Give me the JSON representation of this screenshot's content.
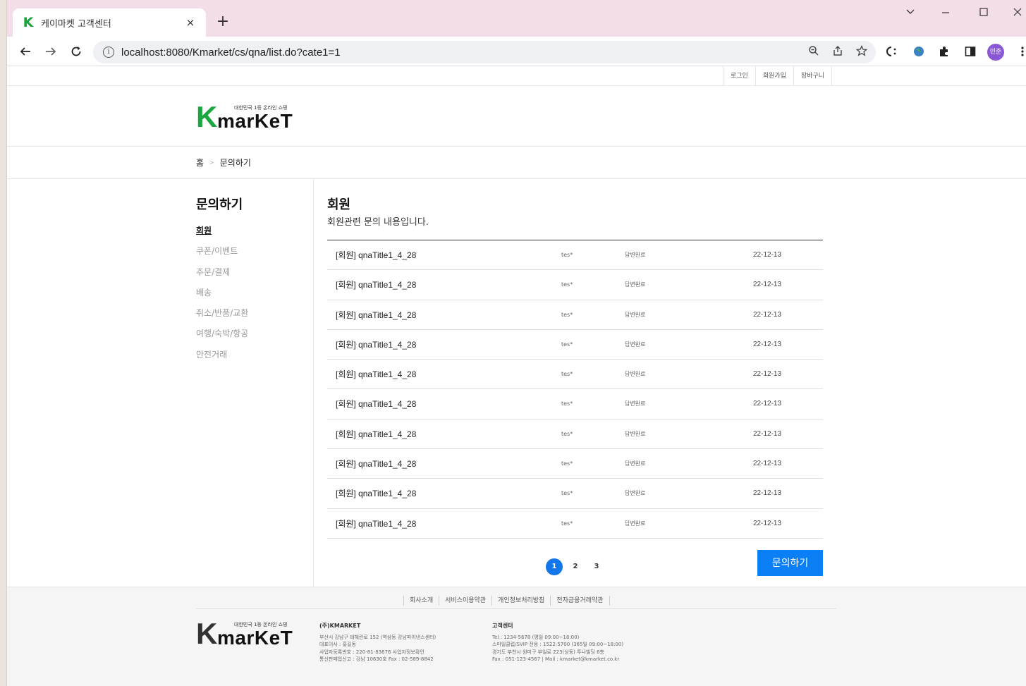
{
  "browser": {
    "tab_title": "케이마켓 고객센터",
    "tab_favicon": "K",
    "tab_close": "×",
    "new_tab": "+",
    "url": "localhost:8080/Kmarket/cs/qna/list.do?cate1=1",
    "profile_label": "민준",
    "icons": [
      "back-icon",
      "forward-icon",
      "reload-icon",
      "info-icon",
      "zoom-icon",
      "share-icon",
      "star-icon",
      "extension-icon",
      "puzzle-icon",
      "sidepanel-icon",
      "menu-icon"
    ]
  },
  "topbar": {
    "links": [
      "로그인",
      "회원가입",
      "장바구니"
    ]
  },
  "logo": {
    "k": "K",
    "word": "marKeT",
    "tagline": "대한민국 1등 온라인 쇼핑"
  },
  "breadcrumb": {
    "home": "홈",
    "current": "문의하기"
  },
  "aside": {
    "title": "문의하기",
    "items": [
      "회원",
      "쿠폰/이벤트",
      "주문/결제",
      "배송",
      "취소/반품/교환",
      "여행/숙박/항공",
      "안전거래"
    ]
  },
  "main": {
    "title": "회원",
    "description": "회원관련 문의 내용입니다.",
    "rows": [
      {
        "title": "[회원] qnaTitle1_4_28",
        "writer": "tes*",
        "status": "답변완료",
        "date": "22-12-13"
      },
      {
        "title": "[회원] qnaTitle1_4_28",
        "writer": "tes*",
        "status": "답변완료",
        "date": "22-12-13"
      },
      {
        "title": "[회원] qnaTitle1_4_28",
        "writer": "tes*",
        "status": "답변완료",
        "date": "22-12-13"
      },
      {
        "title": "[회원] qnaTitle1_4_28",
        "writer": "tes*",
        "status": "답변완료",
        "date": "22-12-13"
      },
      {
        "title": "[회원] qnaTitle1_4_28",
        "writer": "tes*",
        "status": "답변완료",
        "date": "22-12-13"
      },
      {
        "title": "[회원] qnaTitle1_4_28",
        "writer": "tes*",
        "status": "답변완료",
        "date": "22-12-13"
      },
      {
        "title": "[회원] qnaTitle1_4_28",
        "writer": "tes*",
        "status": "답변완료",
        "date": "22-12-13"
      },
      {
        "title": "[회원] qnaTitle1_4_28",
        "writer": "tes*",
        "status": "답변완료",
        "date": "22-12-13"
      },
      {
        "title": "[회원] qnaTitle1_4_28",
        "writer": "tes*",
        "status": "답변완료",
        "date": "22-12-13"
      },
      {
        "title": "[회원] qnaTitle1_4_28",
        "writer": "tes*",
        "status": "답변완료",
        "date": "22-12-13"
      }
    ],
    "pages": [
      "1",
      "2",
      "3"
    ],
    "current_page": "1",
    "ask_button": "문의하기"
  },
  "footer": {
    "links": [
      "회사소개",
      "서비스이용약관",
      "개인정보처리방침",
      "전자금융거래약관"
    ],
    "company": {
      "name": "(주)KMARKET",
      "lines": [
        "부산시 강남구 테헤란로 152 (역삼동 강남파이낸스센터)",
        "대표이사 : 홍길동",
        "사업자등록번호 : 220-81-83676 사업자정보확인",
        "통신판매업신고 : 강남 10630호 Fax : 02-589-8842"
      ]
    },
    "cs": {
      "name": "고객센터",
      "lines": [
        "Tel : 1234-5678 (평일 09:00~18:00)",
        "스마일클럽/SVIP 전용 : 1522-5700 (365일 09:00~18:00)",
        "경기도 부천시 원미구 부일로 223(상동) 투나빌딩 6층",
        "Fax : 051-123-4567 | Mail : kmarket@kmarket.co.kr"
      ]
    }
  },
  "colors": {
    "brand_green": "#1aa640",
    "accent_blue": "#0b7ff6",
    "tabstrip_pink": "#f3dde8"
  }
}
